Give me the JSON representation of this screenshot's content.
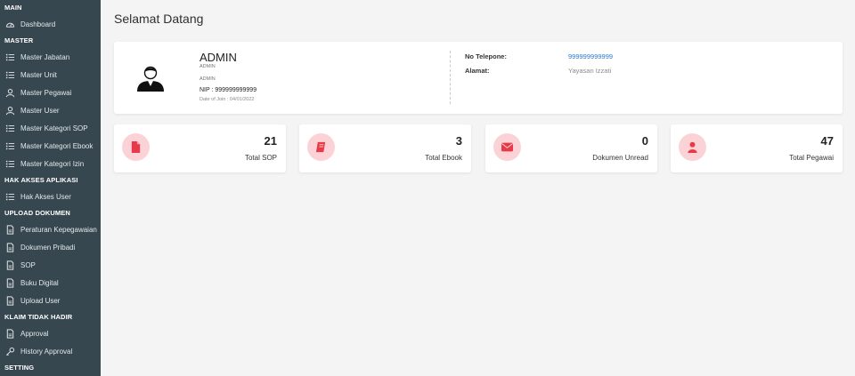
{
  "sidebar": {
    "sections": [
      {
        "title": "MAIN",
        "items": [
          {
            "label": "Dashboard",
            "icon": "dashboard-icon"
          }
        ]
      },
      {
        "title": "MASTER",
        "items": [
          {
            "label": "Master Jabatan",
            "icon": "list-icon"
          },
          {
            "label": "Master Unit",
            "icon": "list-icon"
          },
          {
            "label": "Master Pegawai",
            "icon": "user-icon"
          },
          {
            "label": "Master User",
            "icon": "user-icon"
          },
          {
            "label": "Master Kategori SOP",
            "icon": "list-icon"
          },
          {
            "label": "Master Kategori Ebook",
            "icon": "list-icon"
          },
          {
            "label": "Master Kategori Izin",
            "icon": "list-icon"
          }
        ]
      },
      {
        "title": "HAK AKSES APLIKASI",
        "items": [
          {
            "label": "Hak Akses User",
            "icon": "list-icon"
          }
        ]
      },
      {
        "title": "UPLOAD DOKUMEN",
        "items": [
          {
            "label": "Peraturan Kepegawaian",
            "icon": "document-icon"
          },
          {
            "label": "Dokumen Pribadi",
            "icon": "document-icon"
          },
          {
            "label": "SOP",
            "icon": "document-icon"
          },
          {
            "label": "Buku Digital",
            "icon": "document-icon"
          },
          {
            "label": "Upload User",
            "icon": "document-icon"
          }
        ]
      },
      {
        "title": "KLAIM TIDAK HADIR",
        "items": [
          {
            "label": "Approval",
            "icon": "document-icon"
          },
          {
            "label": "History Approval",
            "icon": "key-icon"
          }
        ]
      },
      {
        "title": "SETTING",
        "items": []
      }
    ]
  },
  "page": {
    "title": "Selamat Datang"
  },
  "profile": {
    "name": "ADMIN",
    "role_line1": "ADMIN",
    "role_line2": "ADMIN",
    "nip": "NIP : 999999999999",
    "join": "Date of Join : 04/01/2022",
    "phone_label": "No Telepone:",
    "phone_value": "999999999999",
    "address_label": "Alamat:",
    "address_value": "Yayasan Izzati"
  },
  "stats": [
    {
      "value": "21",
      "label": "Total SOP",
      "icon": "file-icon"
    },
    {
      "value": "3",
      "label": "Total Ebook",
      "icon": "book-icon"
    },
    {
      "value": "0",
      "label": "Dokumen Unread",
      "icon": "envelope-icon"
    },
    {
      "value": "47",
      "label": "Total Pegawai",
      "icon": "person-icon"
    }
  ],
  "colors": {
    "sidebar_bg": "#37474f",
    "accent": "#e8394a",
    "icon_circle": "#fbd3d7",
    "link": "#2979d6",
    "page_bg": "#f4f4f5"
  }
}
